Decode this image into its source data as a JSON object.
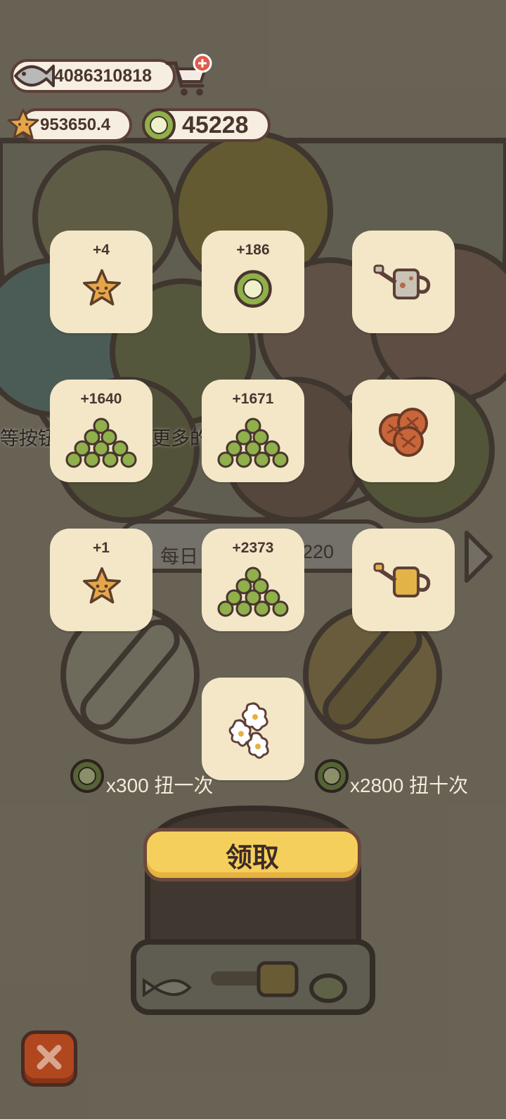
{
  "currencies": {
    "fish": "4086310818",
    "stars": "953650.4",
    "coins": "45228"
  },
  "hint_text": "等按钮就可以招揽更多的顾客",
  "daily": {
    "prefix": "每日",
    "suffix": "220"
  },
  "rewards": [
    {
      "amount": "+4",
      "icon": "star-icon"
    },
    {
      "amount": "+186",
      "icon": "coin-icon"
    },
    {
      "amount": "",
      "icon": "watering-can-icon"
    },
    {
      "amount": "+1640",
      "icon": "coin-pile-icon"
    },
    {
      "amount": "+1671",
      "icon": "coin-pile-icon"
    },
    {
      "amount": "",
      "icon": "bread-icon"
    },
    {
      "amount": "+1",
      "icon": "star-icon"
    },
    {
      "amount": "+2373",
      "icon": "coin-pile-icon"
    },
    {
      "amount": "",
      "icon": "gold-watering-can-icon"
    },
    {
      "amount": "",
      "icon": "flowers-icon"
    }
  ],
  "gacha": {
    "single_label": "x300 扭一次",
    "ten_label": "x2800 扭十次"
  },
  "claim_label": "领取",
  "colors": {
    "tile": "#f3e7c8",
    "claim_button": "#f5cf5c",
    "close_button": "#b0471f",
    "coin_green": "#8fb04a"
  }
}
